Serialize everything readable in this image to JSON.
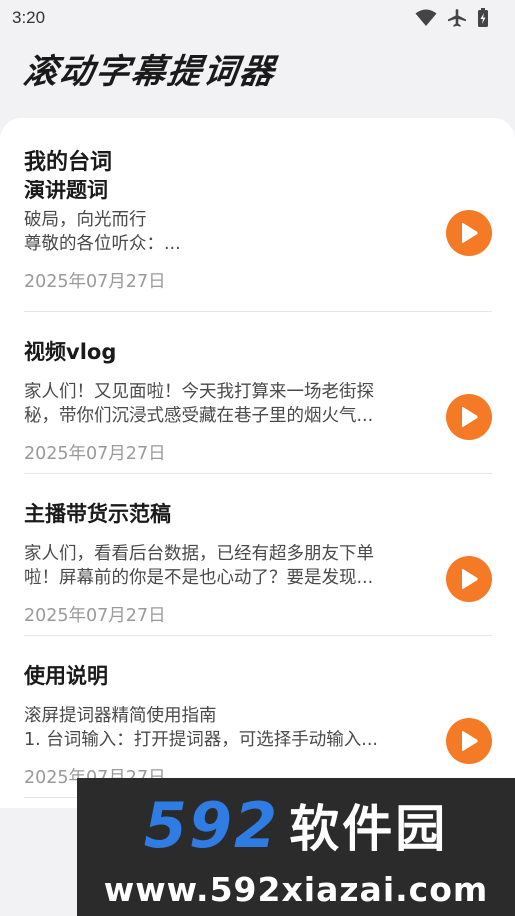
{
  "status_bar": {
    "time": "3:20",
    "icons": [
      "wifi-icon",
      "airplane-icon",
      "battery-icon"
    ]
  },
  "app": {
    "title": "滚动字幕提词器"
  },
  "scripts_section": {
    "title": "我的台词",
    "partial_title": "演讲题词",
    "items": [
      {
        "title": "",
        "preview_line1": "破局，向光而行",
        "preview_line2": "尊敬的各位听众：...",
        "date": "2025年07月27日"
      },
      {
        "title": "视频vlog",
        "preview_line1": "家人们！又见面啦！今天我打算来一场老街探",
        "preview_line2": "秘，带你们沉浸式感受藏在巷子里的烟火气...",
        "date": "2025年07月27日"
      },
      {
        "title": "主播带货示范稿",
        "preview_line1": "家人们，看看后台数据，已经有超多朋友下单",
        "preview_line2": "啦！屏幕前的你是不是也心动了？要是发现...",
        "date": "2025年07月27日"
      },
      {
        "title": "使用说明",
        "preview_line1": "滚屏提词器精简使用指南",
        "preview_line2": "1. 台词输入：打开提词器，可选择手动输入...",
        "date": "2025年07月27日"
      }
    ]
  },
  "colors": {
    "accent": "#f57a26",
    "watermark_blue": "#2f7de3"
  },
  "watermark": {
    "number": "592",
    "brand": "软件园",
    "url": "www.592xiazai.com"
  }
}
